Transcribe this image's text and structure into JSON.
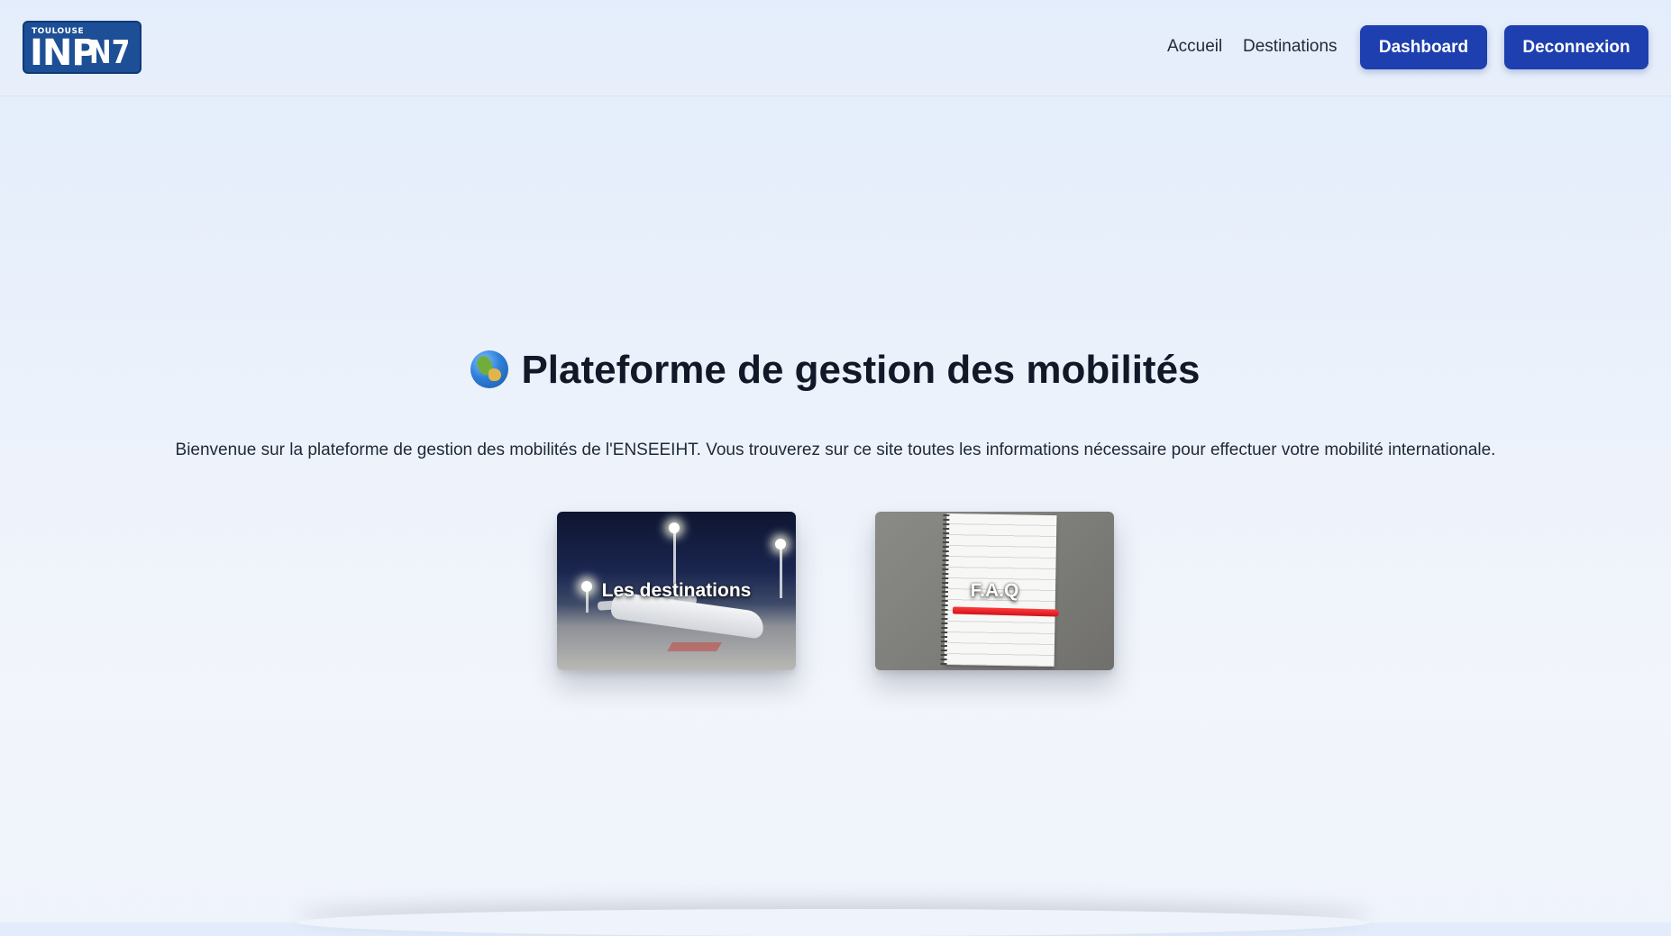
{
  "header": {
    "logo": {
      "alt": "Toulouse INP N7",
      "top_text": "TOULOUSE",
      "main_text": "INP",
      "side_text": "N7"
    },
    "nav": {
      "accueil_label": "Accueil",
      "destinations_label": "Destinations",
      "dashboard_label": "Dashboard",
      "logout_label": "Deconnexion"
    }
  },
  "hero": {
    "title": "Plateforme de gestion des mobilités",
    "title_icon": "globe-icon",
    "subtitle": "Bienvenue sur la plateforme de gestion des mobilités de l'ENSEEIHT. Vous trouverez sur ce site toutes les informations nécessaire pour effectuer votre mobilité internationale."
  },
  "cards": [
    {
      "label": "Les destinations",
      "image": "airplane-at-night"
    },
    {
      "label": "F.A.Q",
      "image": "notebook-with-pen"
    }
  ],
  "colors": {
    "primary_button": "#1e3faf",
    "logo_bg": "#1c4f95",
    "text": "#111827"
  }
}
